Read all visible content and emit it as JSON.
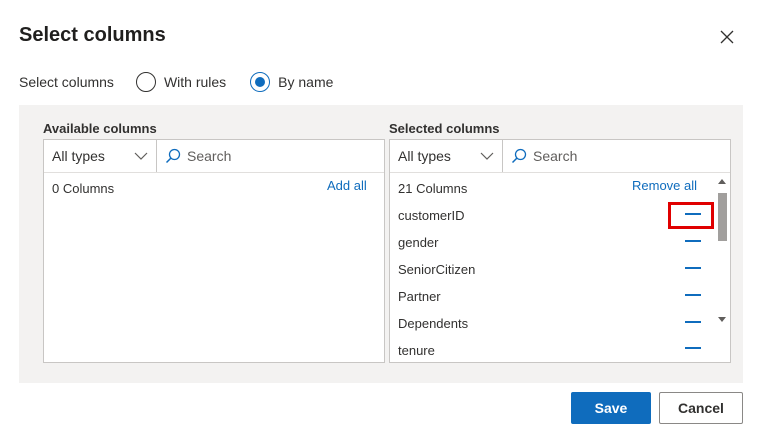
{
  "dialog": {
    "title": "Select columns"
  },
  "mode": {
    "label": "Select columns",
    "options": [
      {
        "label": "With rules",
        "checked": false
      },
      {
        "label": "By name",
        "checked": true
      }
    ]
  },
  "available": {
    "title": "Available columns",
    "type_filter": "All types",
    "search_placeholder": "Search",
    "count_label": "0  Columns",
    "add_all_label": "Add all",
    "items": []
  },
  "selected": {
    "title": "Selected columns",
    "type_filter": "All types",
    "search_placeholder": "Search",
    "count_label": "21  Columns",
    "remove_all_label": "Remove all",
    "items": [
      "customerID",
      "gender",
      "SeniorCitizen",
      "Partner",
      "Dependents",
      "tenure"
    ]
  },
  "footer": {
    "save_label": "Save",
    "cancel_label": "Cancel"
  },
  "icons": {
    "close": "close-icon",
    "chevron": "chevron-down-icon",
    "search": "search-icon",
    "remove": "minus-icon"
  },
  "colors": {
    "accent": "#0f6cbd",
    "highlight": "#e00000",
    "panel_bg": "#f3f2f1"
  }
}
